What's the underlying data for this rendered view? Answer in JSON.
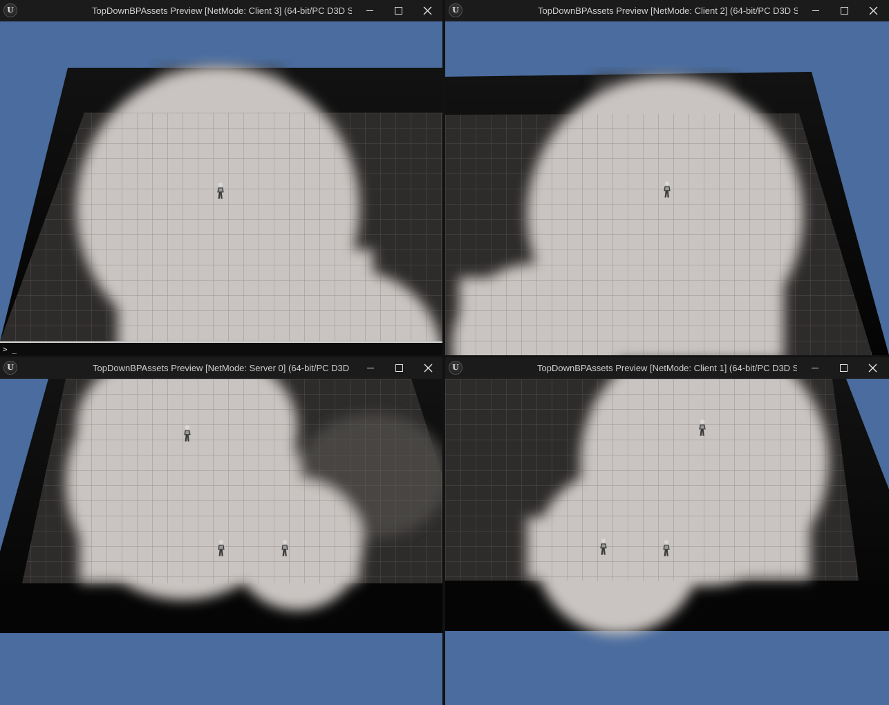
{
  "windows": [
    {
      "id": "client-3",
      "title": "TopDownBPAssets Preview [NetMode: Client 3]  (64-bit/PC D3D S",
      "console_prompt": "> _"
    },
    {
      "id": "client-2",
      "title": "TopDownBPAssets Preview [NetMode: Client 2]  (64-bit/PC D3D S"
    },
    {
      "id": "server-0",
      "title": "TopDownBPAssets Preview [NetMode: Server 0]  (64-bit/PC D3D"
    },
    {
      "id": "client-1",
      "title": "TopDownBPAssets Preview [NetMode: Client 1]  (64-bit/PC D3D S"
    }
  ],
  "app_icon": "unreal-engine-logo-icon",
  "controls": {
    "minimize": "minimize-icon",
    "maximize": "maximize-icon",
    "close": "close-icon"
  },
  "colors": {
    "sky": "#4a6c9e",
    "titlebar": "#1b1b1b",
    "floor_lit": "#c9c4c1",
    "floor_dark": "#2e2c2b",
    "wall": "#070707"
  }
}
